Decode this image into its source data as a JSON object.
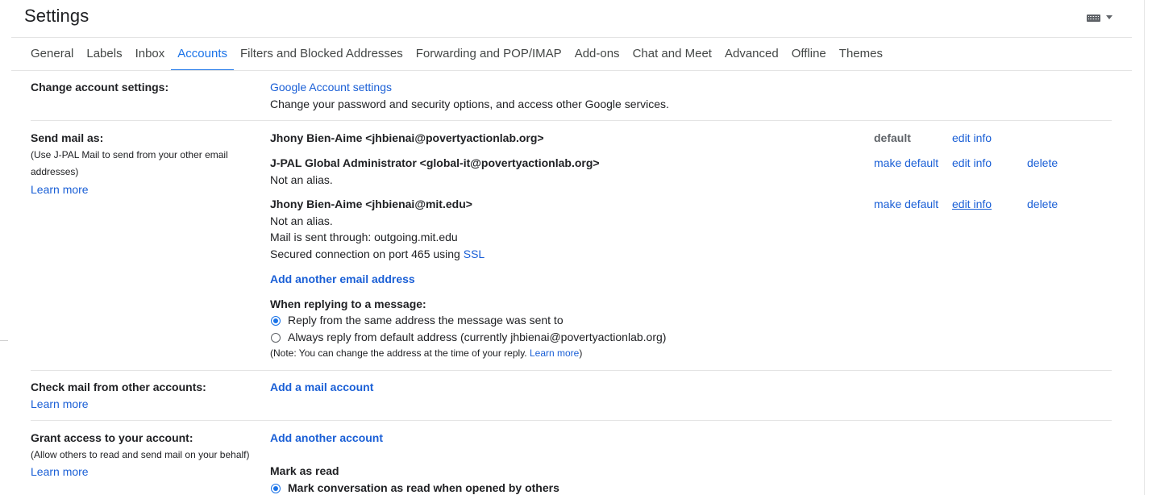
{
  "header": {
    "title": "Settings",
    "input_tools_icon": "keyboard-icon"
  },
  "tabs": [
    {
      "label": "General"
    },
    {
      "label": "Labels"
    },
    {
      "label": "Inbox"
    },
    {
      "label": "Accounts",
      "active": true
    },
    {
      "label": "Filters and Blocked Addresses"
    },
    {
      "label": "Forwarding and POP/IMAP"
    },
    {
      "label": "Add-ons"
    },
    {
      "label": "Chat and Meet"
    },
    {
      "label": "Advanced"
    },
    {
      "label": "Offline"
    },
    {
      "label": "Themes"
    }
  ],
  "change_account": {
    "label": "Change account settings:",
    "link": "Google Account settings",
    "description": "Change your password and security options, and access other Google services."
  },
  "send_mail": {
    "label": "Send mail as:",
    "note_line1": "(Use J-PAL Mail to send from your other email",
    "note_line2": "addresses)",
    "learn_more": "Learn more",
    "addresses": [
      {
        "name": "Jhony Bien-Aime <jhbienai@povertyactionlab.org>",
        "status": "default",
        "edit": "edit info"
      },
      {
        "name": "J-PAL Global Administrator <global-it@povertyactionlab.org>",
        "detail1": "Not an alias.",
        "make_default": "make default",
        "edit": "edit info",
        "delete": "delete"
      },
      {
        "name": "Jhony Bien-Aime <jhbienai@mit.edu>",
        "detail1": "Not an alias.",
        "detail2": "Mail is sent through: outgoing.mit.edu",
        "detail3_prefix": "Secured connection on port 465 using ",
        "detail3_link": "SSL",
        "make_default": "make default",
        "edit": "edit info",
        "delete": "delete"
      }
    ],
    "add_address": "Add another email address",
    "reply_heading": "When replying to a message:",
    "reply_option1": "Reply from the same address the message was sent to",
    "reply_option2": "Always reply from default address (currently jhbienai@povertyactionlab.org)",
    "reply_note_prefix": "(Note: You can change the address at the time of your reply. ",
    "reply_note_link": "Learn more",
    "reply_note_suffix": ")"
  },
  "check_mail": {
    "label": "Check mail from other accounts:",
    "learn_more": "Learn more",
    "action": "Add a mail account"
  },
  "grant_access": {
    "label": "Grant access to your account:",
    "note": "(Allow others to read and send mail on your behalf)",
    "learn_more": "Learn more",
    "action": "Add another account",
    "mark_heading": "Mark as read",
    "mark_option1": "Mark conversation as read when opened by others"
  },
  "colors": {
    "link": "#1a5fd6",
    "active_tab": "#1a73e8",
    "text": "#202124",
    "muted": "#5f6368"
  }
}
